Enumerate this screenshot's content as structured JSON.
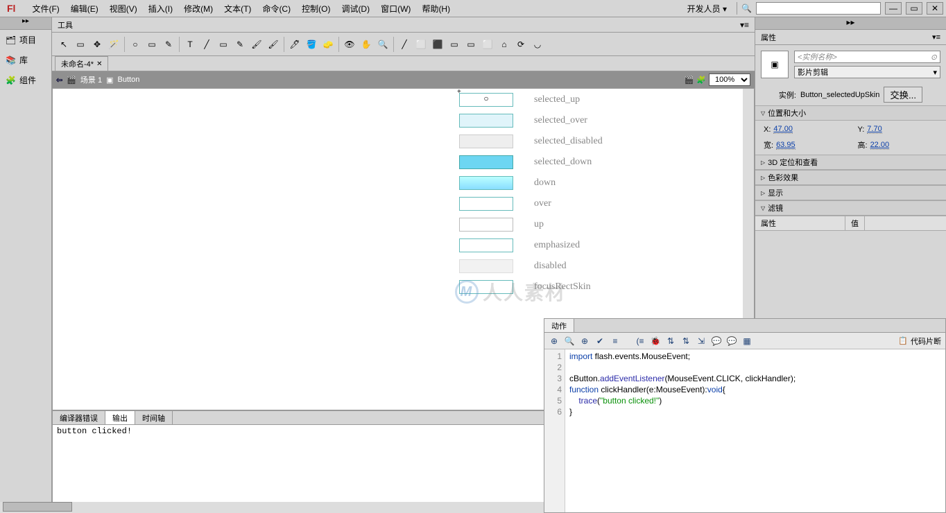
{
  "app_logo": "Fl",
  "menu": [
    "文件(F)",
    "编辑(E)",
    "视图(V)",
    "插入(I)",
    "修改(M)",
    "文本(T)",
    "命令(C)",
    "控制(O)",
    "调试(D)",
    "窗口(W)",
    "帮助(H)"
  ],
  "workspace": "开发人员",
  "search_placeholder": "",
  "left_rail": {
    "items": [
      "项目",
      "库",
      "组件"
    ]
  },
  "tool_panel_title": "工具",
  "doc_tab": "未命名-4*",
  "scene_bar": {
    "scene": "场景 1",
    "symbol": "Button",
    "zoom": "100%"
  },
  "skin_states": [
    {
      "label": "selected_up",
      "style": "background:#fff;border:1px solid #6bb;"
    },
    {
      "label": "selected_over",
      "style": "background:#e0f4fa;border:1px solid #6bb;"
    },
    {
      "label": "selected_disabled",
      "style": "background:#eee;border:1px solid #ccc;"
    },
    {
      "label": "selected_down",
      "style": "background:#6dd6f2;border:1px solid #4aa;"
    },
    {
      "label": "down",
      "style": "background:linear-gradient(#bff,#8df);border:1px solid #6bb;"
    },
    {
      "label": "over",
      "style": "background:#fff;border:1px solid #6bb;"
    },
    {
      "label": "up",
      "style": "background:#fff;border:1px solid #bbb;"
    },
    {
      "label": "emphasized",
      "style": "background:#fff;border:1px solid #6bb;"
    },
    {
      "label": "disabled",
      "style": "background:#f2f2f2;border:1px solid #ddd;"
    },
    {
      "label": "focusRectSkin",
      "style": "background:#fff;border:1px solid #6bb;"
    }
  ],
  "output": {
    "tabs": [
      "编译器错误",
      "输出",
      "时间轴"
    ],
    "active": 1,
    "text": "button clicked!"
  },
  "actions": {
    "tab": "动作",
    "snippets": "代码片断",
    "lines": [
      {
        "n": 1,
        "html": "<span class='kw'>import</span> flash.events.MouseEvent;"
      },
      {
        "n": 2,
        "html": ""
      },
      {
        "n": 3,
        "html": "cButton.<span class='fn'>addEventListener</span>(MouseEvent.CLICK, clickHandler);"
      },
      {
        "n": 4,
        "html": "<span class='kw'>function</span> clickHandler(e:MouseEvent):<span class='kw'>void</span>{"
      },
      {
        "n": 5,
        "html": "    <span class='fn'>trace</span>(<span class='str'>\"button clicked!\"</span>)"
      },
      {
        "n": 6,
        "html": "}"
      }
    ]
  },
  "properties": {
    "panel_title": "属性",
    "instance_placeholder": "<实例名称>",
    "type": "影片剪辑",
    "instance_label": "实例:",
    "instance_name": "Button_selectedUpSkin",
    "swap": "交换...",
    "sections": {
      "pos": "位置和大小",
      "three_d": "3D 定位和查看",
      "color": "色彩效果",
      "display": "显示",
      "filters": "滤镜"
    },
    "pos": {
      "x_label": "X:",
      "x": "47.00",
      "y_label": "Y:",
      "y": "7.70",
      "w_label": "宽:",
      "w": "63.95",
      "h_label": "高:",
      "h": "22.00"
    },
    "filter_cols": [
      "属性",
      "值"
    ]
  },
  "watermark": "人人素材"
}
